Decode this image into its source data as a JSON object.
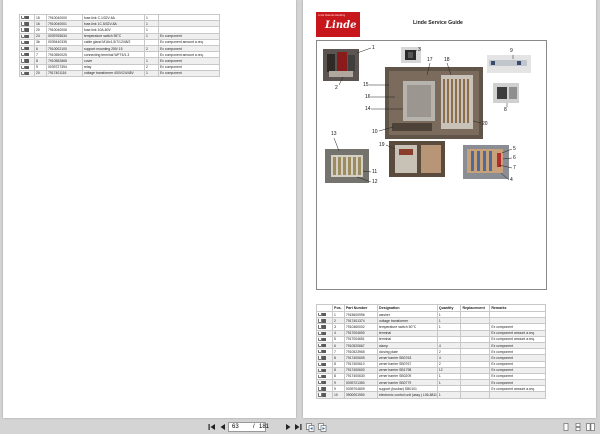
{
  "left_table": {
    "rows": [
      {
        "pos": "15",
        "part": "7910040000",
        "desc": "fuse-link C.1/32V-6A",
        "qty": "1",
        "note": ""
      },
      {
        "pos": "16",
        "part": "7910040001",
        "desc": "fuse-link 1C.5/32V-8A",
        "qty": "1",
        "note": ""
      },
      {
        "pos": "20",
        "part": "7910040006",
        "desc": "fuse-link 10A-60V",
        "qty": "1",
        "note": ""
      },
      {
        "pos": "24",
        "part": "0039765634",
        "desc": "temperature switch 55°C",
        "qty": "1",
        "note": "Ex component"
      },
      {
        "pos": "3b",
        "part": "0039440335",
        "desc": "cable gland M16x1,5/7/12/48/2",
        "qty": "",
        "note": "Ex component amount a.req."
      },
      {
        "pos": "6",
        "part": "7910002100",
        "desc": "support mounting 250/ 15",
        "qty": "2",
        "note": "Ex component"
      },
      {
        "pos": "7",
        "part": "7910550025",
        "desc": "connecting terminal WFT6/1.3",
        "qty": "",
        "note": "Ex component amount a.req."
      },
      {
        "pos": "8",
        "part": "7910552665",
        "desc": "cover",
        "qty": "1",
        "note": "Ex component"
      },
      {
        "pos": "9",
        "part": "0039727394",
        "desc": "relay",
        "qty": "2",
        "note": "Ex component"
      },
      {
        "pos": "20",
        "part": "7917401116",
        "desc": "voltage transformer 400V/24/48V",
        "qty": "1",
        "note": "Ex component"
      }
    ]
  },
  "right_page": {
    "logo_tagline": "Linde Material Handling",
    "logo_text": "Linde",
    "title": "Linde Service Guide",
    "callouts": [
      "1",
      "2",
      "3",
      "9",
      "15",
      "17",
      "18",
      "16",
      "14",
      "10",
      "20",
      "8",
      "13",
      "19",
      "11",
      "12",
      "5",
      "6",
      "7",
      "4"
    ]
  },
  "right_table": {
    "headers": [
      "Pos.",
      "Part Number",
      "Designation",
      "Quantity",
      "Replacement",
      "Remarks"
    ],
    "rows": [
      {
        "pos": "1",
        "part": "7915600996",
        "desc": "washer",
        "qty": "1",
        "repl": "",
        "note": ""
      },
      {
        "pos": "2",
        "part": "7917401374",
        "desc": "voltage transformer",
        "qty": "1",
        "repl": "",
        "note": ""
      },
      {
        "pos": "3",
        "part": "7910460002",
        "desc": "temperature switch 50°C",
        "qty": "1",
        "repl": "",
        "note": "Ex component"
      },
      {
        "pos": "4",
        "part": "7917004690",
        "desc": "terminal",
        "qty": "",
        "repl": "",
        "note": "Ex component amount a.req."
      },
      {
        "pos": "5",
        "part": "7917004651",
        "desc": "terminal",
        "qty": "",
        "repl": "",
        "note": "Ex component amount a.req."
      },
      {
        "pos": "6",
        "part": "7910520667",
        "desc": "clamp",
        "qty": "4",
        "repl": "",
        "note": "Ex component"
      },
      {
        "pos": "7",
        "part": "7910523965",
        "desc": "closing plate",
        "qty": "2",
        "repl": "",
        "note": "Ex component"
      },
      {
        "pos": "8",
        "part": "7917400605",
        "desc": "zener barrier SB0763",
        "qty": "4",
        "repl": "",
        "note": "Ex component"
      },
      {
        "pos": "8",
        "part": "7917400610",
        "desc": "zener barrier SB0767",
        "qty": "2",
        "repl": "",
        "note": "Ex component"
      },
      {
        "pos": "8",
        "part": "7917400600",
        "desc": "zener barrier SB1798",
        "qty": "12",
        "repl": "",
        "note": "Ex component"
      },
      {
        "pos": "8",
        "part": "7917400630",
        "desc": "zener barrier SB0209",
        "qty": "1",
        "repl": "",
        "note": "Ex component"
      },
      {
        "pos": "9",
        "part": "0039721350",
        "desc": "zener barrier SB0779",
        "qty": "1",
        "repl": "",
        "note": "Ex component"
      },
      {
        "pos": "9",
        "part": "0039704809",
        "desc": "support (busbar) SB0101",
        "qty": "",
        "repl": "",
        "note": "Ex component amount a.req."
      },
      {
        "pos": "10",
        "part": "3900001950",
        "desc": "electronic control unit (assy.) L06-8811",
        "qty": "1",
        "repl": "",
        "note": ""
      }
    ]
  },
  "toolbar": {
    "current_page": "63",
    "separator": "/",
    "total_pages": "181"
  }
}
